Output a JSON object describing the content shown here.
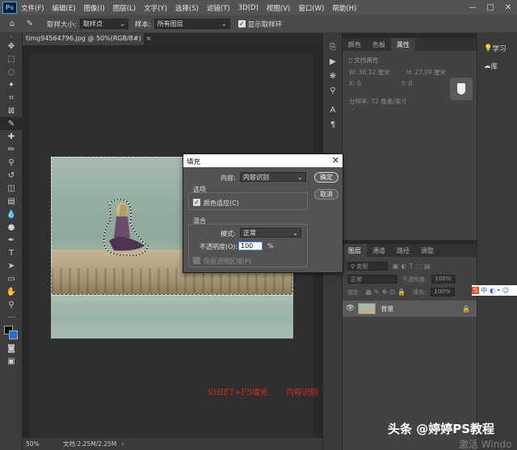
{
  "app": {
    "logo": "Ps"
  },
  "menu": [
    "文件(F)",
    "编辑(E)",
    "图像(I)",
    "图层(L)",
    "文字(Y)",
    "选择(S)",
    "滤镜(T)",
    "3D(D)",
    "视图(V)",
    "窗口(W)",
    "帮助(H)"
  ],
  "window_controls": {
    "minimize": "—",
    "maximize": "□",
    "close": "✕"
  },
  "options": {
    "sample_size_label": "取样大小:",
    "sample_size_value": "取样点",
    "sample_label": "样本:",
    "sample_value": "所有图层",
    "show_ring_label": "显示取样环"
  },
  "document": {
    "tab_title": "timg94564796.jpg @ 50%(RGB/8#)",
    "close": "×"
  },
  "right_panels": {
    "top_tabs": [
      "颜色",
      "色板",
      "属性"
    ],
    "active_top_tab": "属性",
    "doc_props_title": "文档属性",
    "w_label": "W: 36.12 厘米",
    "h_label": "H: 27.09 厘米",
    "x_label": "X: 0",
    "y_label": "Y: 0",
    "resolution": "分辨率: 72 像素/英寸",
    "layer_tabs": [
      "图层",
      "通道",
      "路径",
      "调整"
    ],
    "active_layer_tab": "图层",
    "kind_filter": "类型",
    "blend_mode": "正常",
    "opacity_label": "不透明度:",
    "opacity_value": "100%",
    "lock_label": "锁定:",
    "fill_label": "填充:",
    "fill_value": "100%",
    "layer_name": "背景"
  },
  "side": {
    "learn": "学习",
    "library": "库"
  },
  "ime": {
    "cn": "中"
  },
  "status": {
    "zoom": "50%",
    "doc_size": "文档:2.25M/2.25M"
  },
  "caption": {
    "shortcut": "SHIFT+F5填充",
    "method": "内容识别"
  },
  "watermark": "头条 @婷婷PS教程",
  "activate_windows": "激活 Windo",
  "dialog": {
    "title": "填充",
    "close": "✕",
    "content_label": "内容:",
    "content_value": "内容识别",
    "options_group": "选项",
    "color_adapt_label": "颜色适应(C)",
    "blend_group": "混合",
    "mode_label": "模式:",
    "mode_value": "正常",
    "opacity_label": "不透明度(O):",
    "opacity_value": "100",
    "percent": "%",
    "preserve_label": "保留透明区域(P)",
    "ok": "确定",
    "cancel": "取消"
  }
}
